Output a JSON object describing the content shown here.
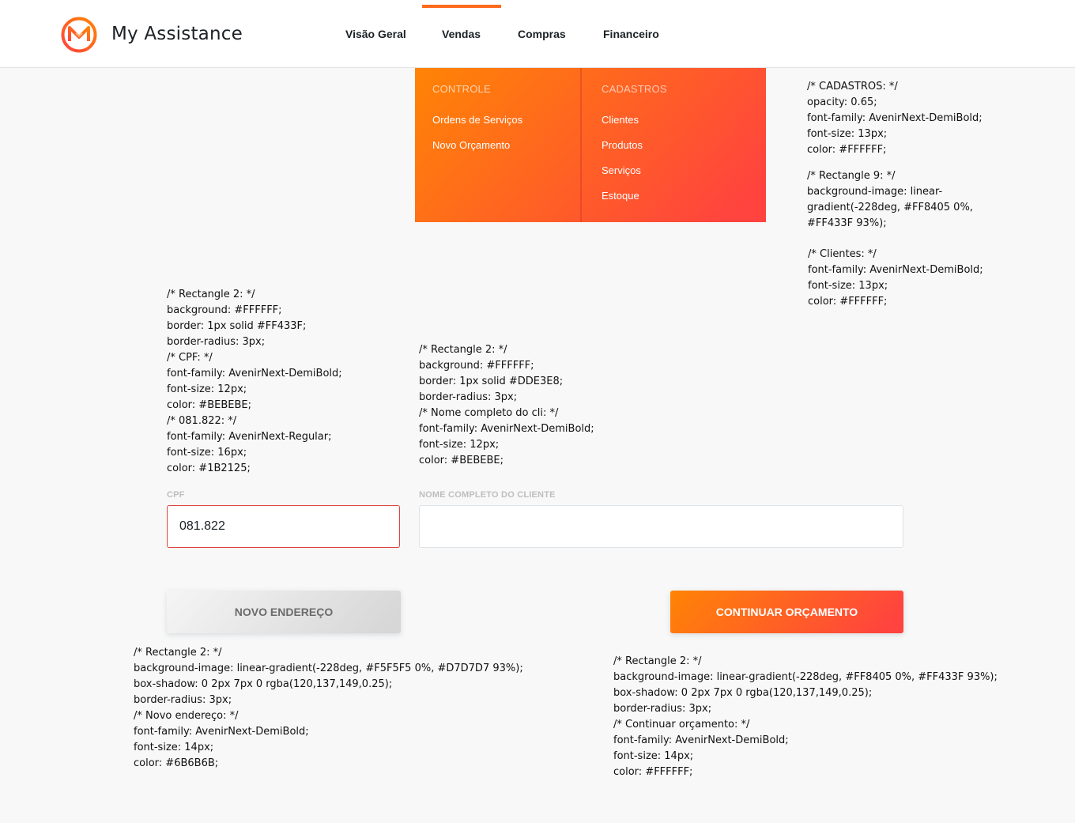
{
  "header": {
    "brand": "My Assistance",
    "nav": [
      {
        "label": "Visão Geral"
      },
      {
        "label": "Vendas",
        "active": true
      },
      {
        "label": "Compras"
      },
      {
        "label": "Financeiro"
      }
    ]
  },
  "colors": {
    "accent_from": "#FF8405",
    "accent_to": "#FF433F",
    "text": "#1B2125",
    "muted": "#BEBEBE"
  },
  "dropdown": {
    "controle": {
      "heading": "CONTROLE",
      "items": [
        "Ordens de Serviços",
        "Novo Orçamento"
      ]
    },
    "cadastros": {
      "heading": "CADASTROS",
      "items": [
        "Clientes",
        "Produtos",
        "Serviços",
        "Estoque"
      ]
    }
  },
  "form": {
    "cpf_label": "CPF",
    "cpf_value": "081.822",
    "name_label": "NOME COMPLETO DO CLIENTE",
    "name_value": "",
    "new_address_button": "NOVO ENDEREÇO",
    "continue_button": "CONTINUAR ORÇAMENTO"
  },
  "notes": {
    "cadastros": "/* CADASTROS: */\nopacity: 0.65;\nfont-family: AvenirNext-DemiBold;\nfont-size: 13px;\ncolor: #FFFFFF;",
    "rect9": "/* Rectangle 9: */\nbackground-image: linear-\ngradient(-228deg, #FF8405 0%,\n#FF433F 93%);",
    "clientes": "/* Clientes: */\nfont-family: AvenirNext-DemiBold;\nfont-size: 13px;\ncolor: #FFFFFF;",
    "cpf": "/* Rectangle 2: */\nbackground: #FFFFFF;\nborder: 1px solid #FF433F;\nborder-radius: 3px;\n/* CPF: */\nfont-family: AvenirNext-DemiBold;\nfont-size: 12px;\ncolor: #BEBEBE;\n/* 081.822: */\nfont-family: AvenirNext-Regular;\nfont-size: 16px;\ncolor: #1B2125;",
    "nome": "/* Rectangle 2: */\nbackground: #FFFFFF;\nborder: 1px solid #DDE3E8;\nborder-radius: 3px;\n/* Nome completo do cli: */\nfont-family: AvenirNext-DemiBold;\nfont-size: 12px;\ncolor: #BEBEBE;",
    "novo_endereco": "/* Rectangle 2: */\nbackground-image: linear-gradient(-228deg, #F5F5F5 0%, #D7D7D7 93%);\nbox-shadow: 0 2px 7px 0 rgba(120,137,149,0.25);\nborder-radius: 3px;\n/* Novo endereço: */\nfont-family: AvenirNext-DemiBold;\nfont-size: 14px;\ncolor: #6B6B6B;",
    "continuar": "/* Rectangle 2: */\nbackground-image: linear-gradient(-228deg, #FF8405 0%, #FF433F 93%);\nbox-shadow: 0 2px 7px 0 rgba(120,137,149,0.25);\nborder-radius: 3px;\n/* Continuar orçamento: */\nfont-family: AvenirNext-DemiBold;\nfont-size: 14px;\ncolor: #FFFFFF;"
  }
}
